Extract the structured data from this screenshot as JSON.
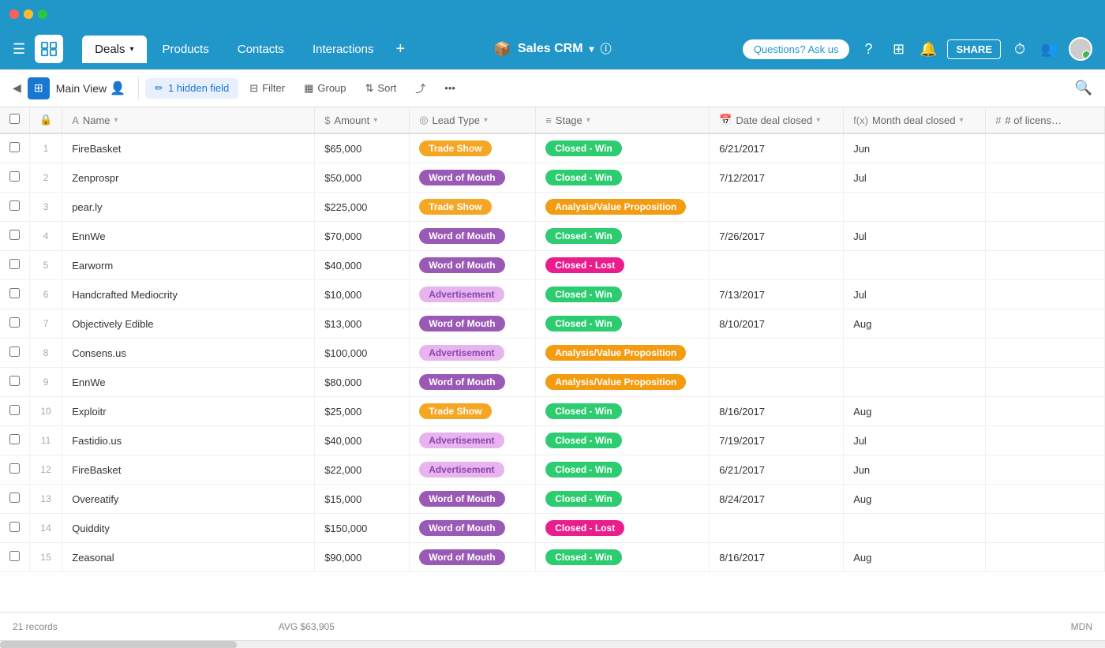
{
  "titleBar": {
    "trafficLights": [
      "red",
      "yellow",
      "green"
    ]
  },
  "topNav": {
    "appTitle": "Sales CRM",
    "appTitleDropdown": "▾",
    "infoIcon": "ⓘ",
    "tabs": [
      {
        "id": "deals",
        "label": "Deals",
        "active": true,
        "hasDropdown": true
      },
      {
        "id": "products",
        "label": "Products",
        "active": false
      },
      {
        "id": "contacts",
        "label": "Contacts",
        "active": false
      },
      {
        "id": "interactions",
        "label": "Interactions",
        "active": false
      }
    ],
    "addTab": "+",
    "askUsLabel": "Questions? Ask us",
    "shareLabel": "SHARE"
  },
  "toolbar": {
    "viewLabel": "Main View",
    "hiddenFieldLabel": "1 hidden field",
    "filterLabel": "Filter",
    "groupLabel": "Group",
    "sortLabel": "Sort"
  },
  "table": {
    "columns": [
      {
        "id": "name",
        "label": "Name",
        "icon": "A",
        "iconType": "text"
      },
      {
        "id": "amount",
        "label": "Amount",
        "icon": "$",
        "iconType": "dollar"
      },
      {
        "id": "leadType",
        "label": "Lead Type",
        "icon": "◎",
        "iconType": "tag"
      },
      {
        "id": "stage",
        "label": "Stage",
        "icon": "≡",
        "iconType": "list"
      },
      {
        "id": "dateClosed",
        "label": "Date deal closed",
        "icon": "📅",
        "iconType": "cal"
      },
      {
        "id": "monthClosed",
        "label": "Month deal closed",
        "icon": "f(x)",
        "iconType": "func"
      },
      {
        "id": "licenses",
        "label": "# of licens…",
        "icon": "#",
        "iconType": "hash"
      }
    ],
    "rows": [
      {
        "num": 1,
        "name": "FireBasket",
        "amount": "$65,000",
        "leadType": "Trade Show",
        "leadTypeClass": "trade-show",
        "stage": "Closed - Win",
        "stageClass": "closed-win",
        "dateClosed": "6/21/2017",
        "monthClosed": "Jun"
      },
      {
        "num": 2,
        "name": "Zenprospr",
        "amount": "$50,000",
        "leadType": "Word of Mouth",
        "leadTypeClass": "word-of-mouth",
        "stage": "Closed - Win",
        "stageClass": "closed-win",
        "dateClosed": "7/12/2017",
        "monthClosed": "Jul"
      },
      {
        "num": 3,
        "name": "pear.ly",
        "amount": "$225,000",
        "leadType": "Trade Show",
        "leadTypeClass": "trade-show",
        "stage": "Analysis/Value Proposition",
        "stageClass": "analysis",
        "dateClosed": "",
        "monthClosed": ""
      },
      {
        "num": 4,
        "name": "EnnWe",
        "amount": "$70,000",
        "leadType": "Word of Mouth",
        "leadTypeClass": "word-of-mouth",
        "stage": "Closed - Win",
        "stageClass": "closed-win",
        "dateClosed": "7/26/2017",
        "monthClosed": "Jul"
      },
      {
        "num": 5,
        "name": "Earworm",
        "amount": "$40,000",
        "leadType": "Word of Mouth",
        "leadTypeClass": "word-of-mouth",
        "stage": "Closed - Lost",
        "stageClass": "closed-lost",
        "dateClosed": "",
        "monthClosed": ""
      },
      {
        "num": 6,
        "name": "Handcrafted Mediocrity",
        "amount": "$10,000",
        "leadType": "Advertisement",
        "leadTypeClass": "advertisement",
        "stage": "Closed - Win",
        "stageClass": "closed-win",
        "dateClosed": "7/13/2017",
        "monthClosed": "Jul"
      },
      {
        "num": 7,
        "name": "Objectively Edible",
        "amount": "$13,000",
        "leadType": "Word of Mouth",
        "leadTypeClass": "word-of-mouth",
        "stage": "Closed - Win",
        "stageClass": "closed-win",
        "dateClosed": "8/10/2017",
        "monthClosed": "Aug"
      },
      {
        "num": 8,
        "name": "Consens.us",
        "amount": "$100,000",
        "leadType": "Advertisement",
        "leadTypeClass": "advertisement",
        "stage": "Analysis/Value Proposition",
        "stageClass": "analysis",
        "dateClosed": "",
        "monthClosed": ""
      },
      {
        "num": 9,
        "name": "EnnWe",
        "amount": "$80,000",
        "leadType": "Word of Mouth",
        "leadTypeClass": "word-of-mouth",
        "stage": "Analysis/Value Proposition",
        "stageClass": "analysis",
        "dateClosed": "",
        "monthClosed": ""
      },
      {
        "num": 10,
        "name": "Exploitr",
        "amount": "$25,000",
        "leadType": "Trade Show",
        "leadTypeClass": "trade-show",
        "stage": "Closed - Win",
        "stageClass": "closed-win",
        "dateClosed": "8/16/2017",
        "monthClosed": "Aug"
      },
      {
        "num": 11,
        "name": "Fastidio.us",
        "amount": "$40,000",
        "leadType": "Advertisement",
        "leadTypeClass": "advertisement",
        "stage": "Closed - Win",
        "stageClass": "closed-win",
        "dateClosed": "7/19/2017",
        "monthClosed": "Jul"
      },
      {
        "num": 12,
        "name": "FireBasket",
        "amount": "$22,000",
        "leadType": "Advertisement",
        "leadTypeClass": "advertisement",
        "stage": "Closed - Win",
        "stageClass": "closed-win",
        "dateClosed": "6/21/2017",
        "monthClosed": "Jun"
      },
      {
        "num": 13,
        "name": "Overeatify",
        "amount": "$15,000",
        "leadType": "Word of Mouth",
        "leadTypeClass": "word-of-mouth",
        "stage": "Closed - Win",
        "stageClass": "closed-win",
        "dateClosed": "8/24/2017",
        "monthClosed": "Aug"
      },
      {
        "num": 14,
        "name": "Quiddity",
        "amount": "$150,000",
        "leadType": "Word of Mouth",
        "leadTypeClass": "word-of-mouth",
        "stage": "Closed - Lost",
        "stageClass": "closed-lost",
        "dateClosed": "",
        "monthClosed": ""
      },
      {
        "num": 15,
        "name": "Zeasonal",
        "amount": "$90,000",
        "leadType": "Word of Mouth",
        "leadTypeClass": "word-of-mouth",
        "stage": "Closed - Win",
        "stageClass": "closed-win",
        "dateClosed": "8/16/2017",
        "monthClosed": "Aug"
      }
    ]
  },
  "footer": {
    "recordsLabel": "21 records",
    "avgLabel": "AVG $63,905",
    "mdnLabel": "MDN"
  }
}
